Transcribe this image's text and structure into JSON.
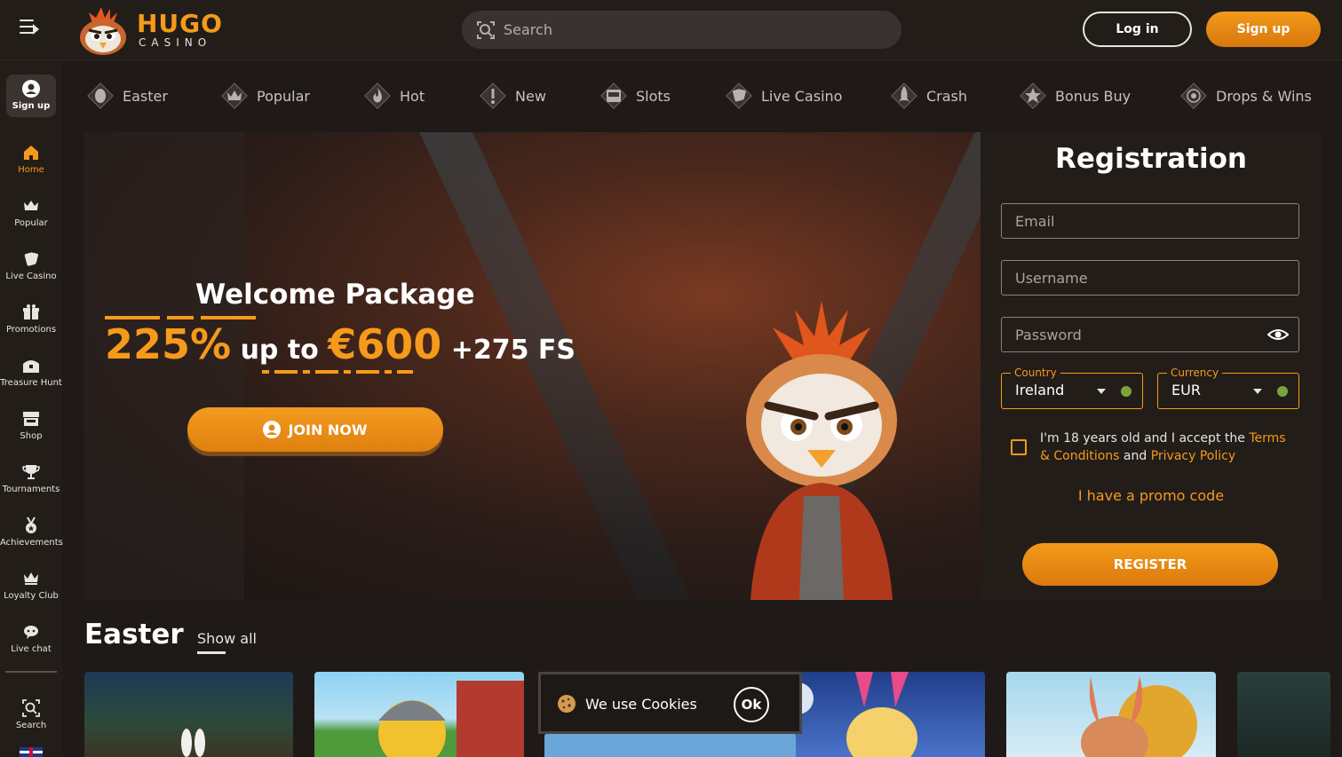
{
  "header": {
    "logo_word": "HUGO",
    "logo_sub": "CASINO",
    "search_placeholder": "Search",
    "login_label": "Log in",
    "signup_label": "Sign up"
  },
  "sidebar": {
    "signup_label": "Sign up",
    "items": [
      {
        "label": "Home",
        "icon": "home-icon",
        "active": true
      },
      {
        "label": "Popular",
        "icon": "crown-icon"
      },
      {
        "label": "Live Casino",
        "icon": "cards-icon"
      },
      {
        "label": "Promotions",
        "icon": "gift-icon"
      },
      {
        "label": "Treasure Hunt",
        "icon": "treasure-chest-icon"
      },
      {
        "label": "Shop",
        "icon": "shop-icon"
      },
      {
        "label": "Tournaments",
        "icon": "trophy-icon"
      },
      {
        "label": "Achievements",
        "icon": "medal-icon"
      },
      {
        "label": "Loyalty Club",
        "icon": "crown-icon"
      },
      {
        "label": "Live chat",
        "icon": "chat-icon"
      }
    ],
    "search_label": "Search"
  },
  "categories": [
    {
      "label": "Easter",
      "icon": "egg-icon"
    },
    {
      "label": "Popular",
      "icon": "crown-icon"
    },
    {
      "label": "Hot",
      "icon": "flame-icon"
    },
    {
      "label": "New",
      "icon": "exclamation-icon"
    },
    {
      "label": "Slots",
      "icon": "slot-machine-icon"
    },
    {
      "label": "Live Casino",
      "icon": "cards-icon"
    },
    {
      "label": "Crash",
      "icon": "rocket-icon"
    },
    {
      "label": "Bonus Buy",
      "icon": "bonus-icon"
    },
    {
      "label": "Drops & Wins",
      "icon": "drops-wins-icon"
    }
  ],
  "hero": {
    "title": "Welcome Package",
    "bonus_percent": "225%",
    "bonus_mid": " up to ",
    "bonus_amount": "€600",
    "bonus_fs": " +275 FS",
    "join_label": "JOIN NOW"
  },
  "registration": {
    "title": "Registration",
    "email_placeholder": "Email",
    "username_placeholder": "Username",
    "password_placeholder": "Password",
    "country_label": "Country",
    "country_value": "Ireland",
    "currency_label": "Currency",
    "currency_value": "EUR",
    "terms_pre": "I'm 18 years old and I accept the ",
    "terms_link": "Terms & Conditions",
    "terms_mid": " and ",
    "privacy_link": "Privacy Policy",
    "promo_label": "I have a promo code",
    "register_label": "REGISTER"
  },
  "easter_section": {
    "title": "Easter",
    "show_all": "Show all"
  },
  "cookie": {
    "text": "We use Cookies",
    "ok_label": "Ok"
  },
  "colors": {
    "accent": "#f59a1a",
    "background": "#1f1a17",
    "panel": "#231d1a"
  }
}
